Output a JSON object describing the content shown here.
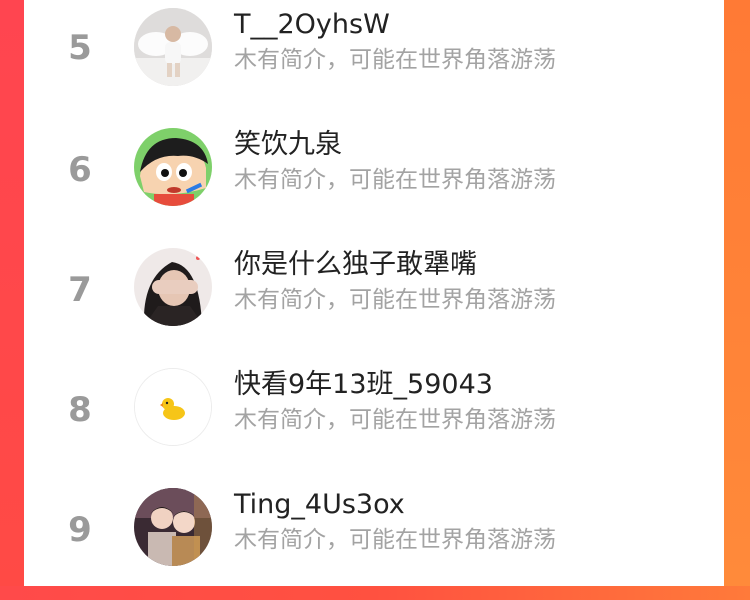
{
  "ranking": {
    "entries": [
      {
        "rank": "5",
        "name": "T__2OyhsW",
        "bio": "木有简介，可能在世界角落游荡",
        "avatar": "angel-photo-icon"
      },
      {
        "rank": "6",
        "name": "笑饮九泉",
        "bio": "木有简介，可能在世界角落游荡",
        "avatar": "crayon-shin-chan-icon"
      },
      {
        "rank": "7",
        "name": "你是什么独子敢犟嘴",
        "bio": "木有简介，可能在世界角落游荡",
        "avatar": "girl-covering-face-icon"
      },
      {
        "rank": "8",
        "name": "快看9年13班_59043",
        "bio": "木有简介，可能在世界角落游荡",
        "avatar": "yellow-duck-icon"
      },
      {
        "rank": "9",
        "name": "Ting_4Us3ox",
        "bio": "木有简介，可能在世界角落游荡",
        "avatar": "couple-photo-icon"
      }
    ]
  },
  "colors": {
    "accent_left": "#ff4550",
    "accent_right": "#ff7a35",
    "rank_gray": "#9a9a9a",
    "bio_gray": "#a3a3a3"
  }
}
